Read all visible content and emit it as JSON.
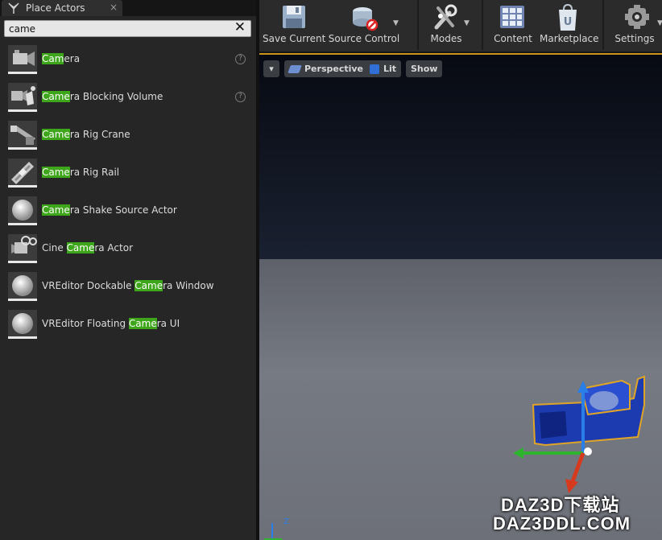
{
  "panel": {
    "tab_title": "Place Actors",
    "close_glyph": "×",
    "search": {
      "value": "came",
      "clear_glyph": "✕"
    },
    "items": [
      {
        "pre": "",
        "hl": "Cam",
        "post": "era",
        "icon": "camera-icon",
        "help": true
      },
      {
        "pre": "",
        "hl": "Came",
        "post": "ra Blocking Volume",
        "icon": "camera-blocking-volume-icon",
        "help": true
      },
      {
        "pre": "",
        "hl": "Came",
        "post": "ra Rig Crane",
        "icon": "rig-crane-icon",
        "help": false
      },
      {
        "pre": "",
        "hl": "Came",
        "post": "ra Rig Rail",
        "icon": "rig-rail-icon",
        "help": false
      },
      {
        "pre": "",
        "hl": "Came",
        "post": "ra Shake Source Actor",
        "icon": "sphere-icon",
        "help": false
      },
      {
        "pre": "Cine ",
        "hl": "Came",
        "post": "ra Actor",
        "icon": "cine-camera-icon",
        "help": false
      },
      {
        "pre": "VREditor Dockable ",
        "hl": "Came",
        "post": "ra Window",
        "icon": "sphere-icon",
        "help": false
      },
      {
        "pre": "VREditor Floating ",
        "hl": "Came",
        "post": "ra UI",
        "icon": "sphere-icon",
        "help": false
      }
    ],
    "help_glyph": "?"
  },
  "toolbar": {
    "save_current": "Save Current",
    "source_control": "Source Control",
    "modes": "Modes",
    "content": "Content",
    "marketplace": "Marketplace",
    "settings": "Settings"
  },
  "viewport": {
    "menu_caret": "▾",
    "perspective": "Perspective",
    "lit": "Lit",
    "show": "Show",
    "axis_z": "Z"
  },
  "watermark": {
    "line1": "DAZ3D下载站",
    "line2": "DAZ3DDL.COM"
  },
  "colors": {
    "highlight": "#3ea61a",
    "selection_outline": "#c9961a",
    "accent_blue": "#2f6fd6"
  }
}
